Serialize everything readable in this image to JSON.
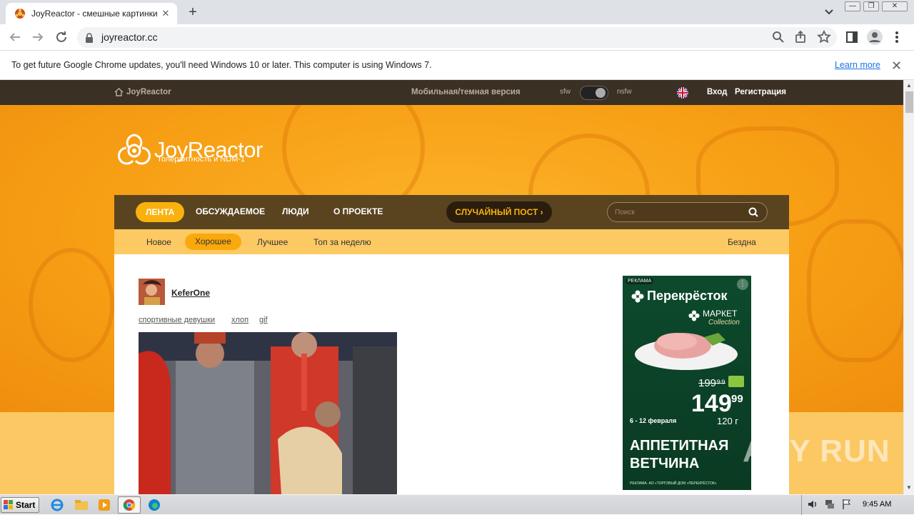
{
  "browser": {
    "tab_title": "JoyReactor - смешные картинки и",
    "tab_close": "✕",
    "new_tab": "+",
    "url": "joyreactor.cc",
    "window_buttons": [
      "—",
      "❐",
      "✕"
    ]
  },
  "infobar": {
    "message": "To get future Google Chrome updates, you'll need Windows 10 or later. This computer is using Windows 7.",
    "link": "Learn more",
    "close": "✕"
  },
  "site": {
    "home_label": "JoyReactor",
    "mobile_link": "Мобильная/темная версия",
    "sfw": "sfw",
    "nsfw": "nsfw",
    "login": "Вход",
    "register": "Регистрация",
    "logo_name": "JoyReactor",
    "logo_tagline": "Толерантность и NDM-1"
  },
  "main_nav": {
    "feed": "ЛЕНТА",
    "discussed": "ОБСУЖДАЕМОЕ",
    "people": "ЛЮДИ",
    "about": "О ПРОЕКТЕ",
    "random": "СЛУЧАЙНЫЙ ПОСТ ›",
    "search_placeholder": "Поиск"
  },
  "sub_nav": {
    "new": "Новое",
    "good": "Хорошее",
    "best": "Лучшее",
    "top_week": "Топ за неделю",
    "abyss": "Бездна"
  },
  "post": {
    "author": "KeferOne",
    "tags": [
      "спортивные девушки",
      "хлоп",
      "gif"
    ]
  },
  "ad": {
    "label": "РЕКЛАМА",
    "menu": "⋮",
    "brand": "Перекрёсток",
    "market": "МАРКЕТ",
    "collection": "Collection",
    "old_price": "199⁹⁹",
    "price": "149",
    "cents": "99",
    "weight": "120 г",
    "dates": "6 - 12 февраля",
    "headline_1": "АППЕТИТНАЯ",
    "headline_2": "ВЕТЧИНА",
    "fine_print": "РЕКЛАМА. АО «ТОРГОВЫЙ ДОМ «ПЕРЕКРЁСТОК»"
  },
  "watermark": "ANY RUN",
  "taskbar": {
    "start": "Start",
    "clock": "9:45 AM"
  },
  "colors": {
    "accent": "#f9b10d",
    "nav_bg": "#5a4420",
    "top_strip": "#3b3024",
    "page_orange": "#f7a51d"
  }
}
